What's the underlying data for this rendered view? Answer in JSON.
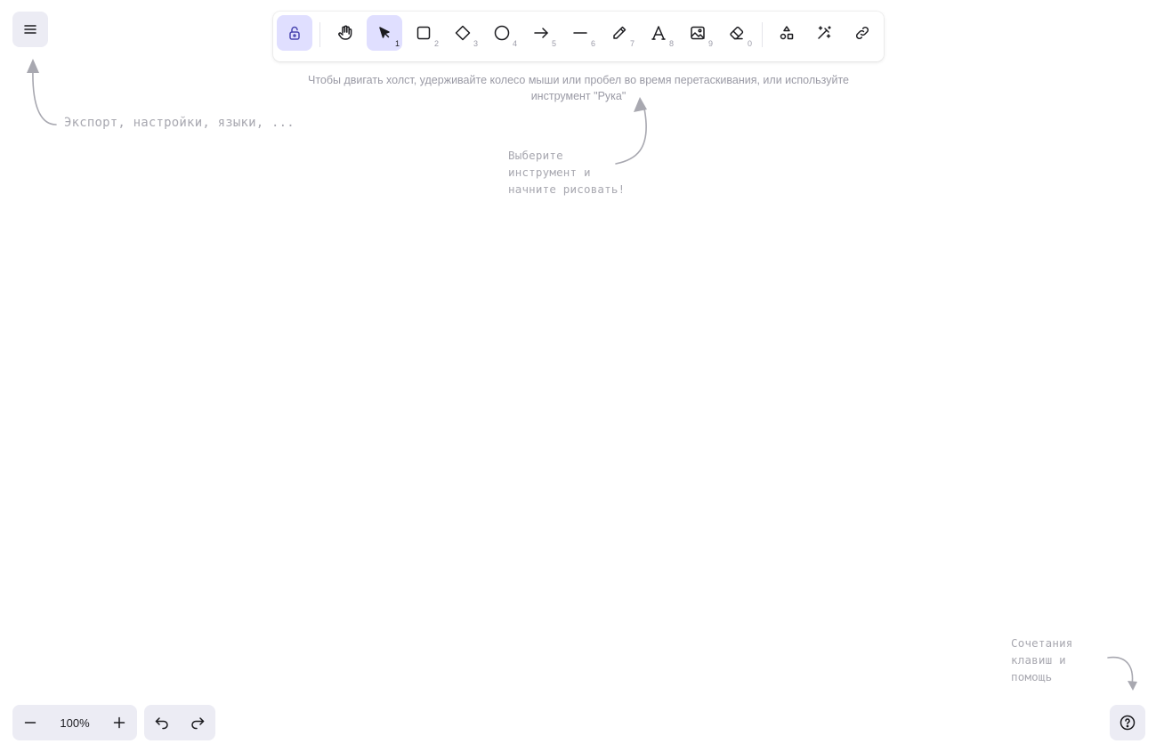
{
  "toolbar": {
    "tools": [
      {
        "name": "lock",
        "icon": "lock-icon",
        "key": "",
        "active": true
      },
      {
        "name": "hand",
        "icon": "hand-icon",
        "key": "",
        "active": false
      },
      {
        "name": "selection",
        "icon": "pointer-icon",
        "key": "1",
        "active": true
      },
      {
        "name": "rectangle",
        "icon": "rectangle-icon",
        "key": "2",
        "active": false
      },
      {
        "name": "diamond",
        "icon": "diamond-icon",
        "key": "3",
        "active": false
      },
      {
        "name": "ellipse",
        "icon": "ellipse-icon",
        "key": "4",
        "active": false
      },
      {
        "name": "arrow",
        "icon": "arrow-icon",
        "key": "5",
        "active": false
      },
      {
        "name": "line",
        "icon": "line-icon",
        "key": "6",
        "active": false
      },
      {
        "name": "draw",
        "icon": "pencil-icon",
        "key": "7",
        "active": false
      },
      {
        "name": "text",
        "icon": "text-icon",
        "key": "8",
        "active": false
      },
      {
        "name": "image",
        "icon": "image-icon",
        "key": "9",
        "active": false
      },
      {
        "name": "eraser",
        "icon": "eraser-icon",
        "key": "0",
        "active": false
      },
      {
        "name": "library",
        "icon": "shapes-icon",
        "key": "",
        "active": false
      },
      {
        "name": "magic",
        "icon": "magic-wand-icon",
        "key": "",
        "active": false
      },
      {
        "name": "embed",
        "icon": "link-icon",
        "key": "",
        "active": false
      }
    ]
  },
  "hints": {
    "canvas_move": "Чтобы двигать холст, удерживайте колесо мыши или пробел во время перетаскивания, или используйте инструмент \"Рука\"",
    "menu": "Экспорт, настройки, языки, ...",
    "tool": "Выберите инструмент и начните рисовать!",
    "help": "Сочетания клавиш и помощь"
  },
  "zoom": {
    "value": "100%"
  },
  "colors": {
    "accent_bg": "#e0dfff",
    "panel_bg": "#ececf4",
    "hint_text": "#9a9aa5"
  }
}
